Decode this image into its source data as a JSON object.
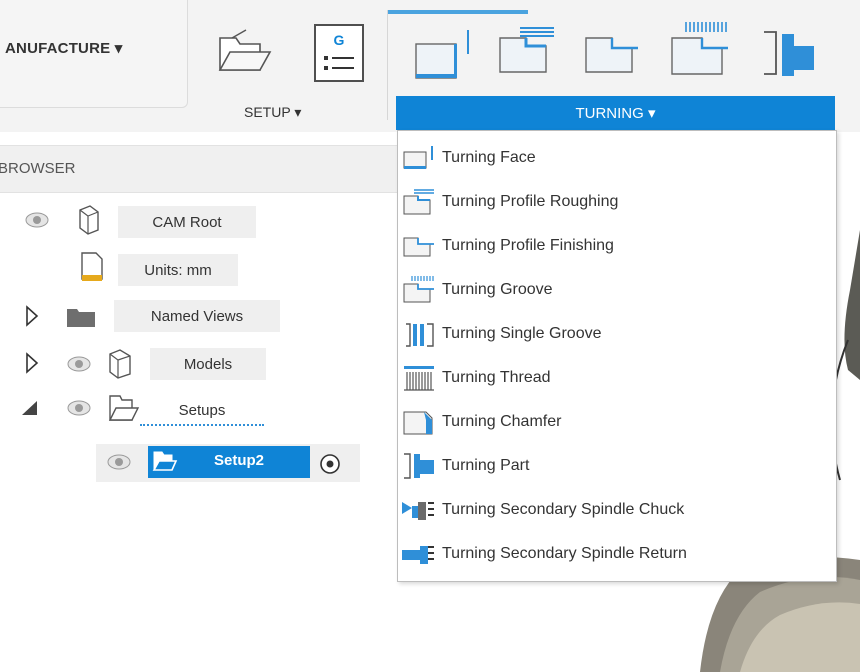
{
  "toolbar": {
    "workspace_label": "ANUFACTURE ▾",
    "setup_label": "SETUP ▾",
    "setup_icon_letter": "G",
    "turning_label": "TURNING ▾",
    "colors": {
      "accent": "#0f84d6",
      "active_line": "#4aa3df"
    }
  },
  "browser": {
    "title": "BROWSER",
    "items": [
      {
        "label": "CAM Root"
      },
      {
        "label": "Units: mm"
      },
      {
        "label": "Named Views"
      },
      {
        "label": "Models"
      },
      {
        "label": "Setups"
      },
      {
        "label": "Setup2"
      }
    ]
  },
  "menu": {
    "items": [
      {
        "label": "Turning Face",
        "icon": "turning-face-icon"
      },
      {
        "label": "Turning Profile Roughing",
        "icon": "turning-profile-roughing-icon"
      },
      {
        "label": "Turning Profile Finishing",
        "icon": "turning-profile-finishing-icon"
      },
      {
        "label": "Turning Groove",
        "icon": "turning-groove-icon"
      },
      {
        "label": "Turning Single Groove",
        "icon": "turning-single-groove-icon"
      },
      {
        "label": "Turning Thread",
        "icon": "turning-thread-icon"
      },
      {
        "label": "Turning Chamfer",
        "icon": "turning-chamfer-icon"
      },
      {
        "label": "Turning Part",
        "icon": "turning-part-icon"
      },
      {
        "label": "Turning Secondary Spindle Chuck",
        "icon": "secondary-spindle-chuck-icon"
      },
      {
        "label": "Turning Secondary Spindle Return",
        "icon": "secondary-spindle-return-icon"
      }
    ]
  }
}
